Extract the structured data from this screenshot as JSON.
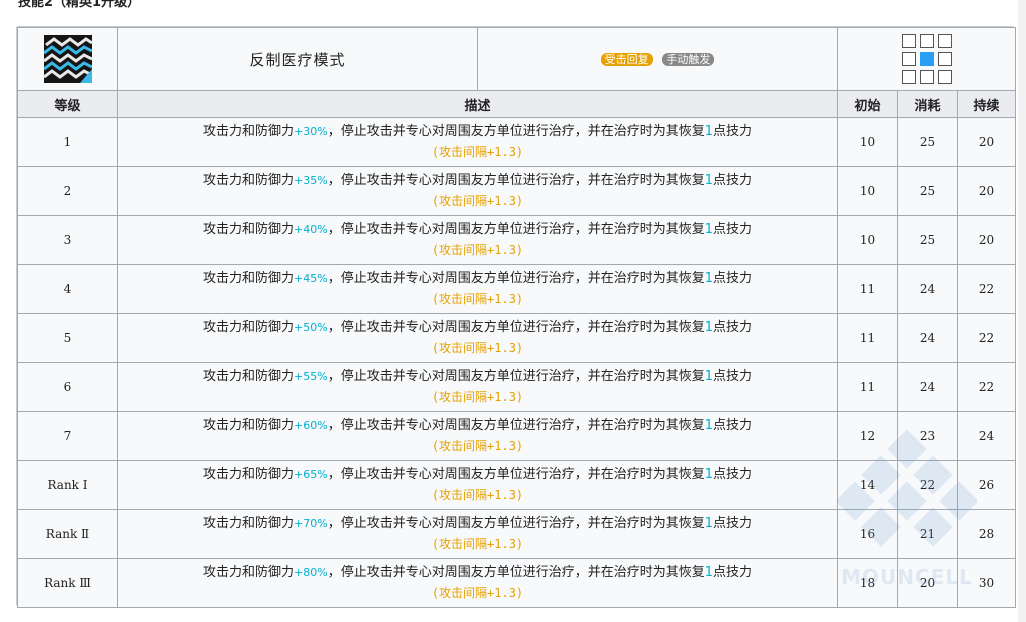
{
  "heading": "技能2（精英1升级）",
  "skill": {
    "name": "反制医疗模式",
    "sp_type": "受击回复",
    "trigger": "手动触发",
    "icon": "skill-icon-zigzag-chains"
  },
  "range": {
    "grid": [
      [
        0,
        0,
        0
      ],
      [
        0,
        1,
        0
      ],
      [
        0,
        0,
        0
      ]
    ]
  },
  "columns": {
    "level": "等级",
    "description": "描述",
    "initial": "初始",
    "cost": "消耗",
    "duration": "持续"
  },
  "rows": [
    {
      "level": "1",
      "desc_pre": "攻击力和防御力",
      "pct": "+30%",
      "desc_mid": "，停止攻击并专心对周围友方单位进行治疗，并在治疗时为其恢复",
      "sp_restore": "1",
      "desc_post": "点技力",
      "interval": "(攻击间隔+1.3)",
      "initial": "10",
      "cost": "25",
      "duration": "20"
    },
    {
      "level": "2",
      "desc_pre": "攻击力和防御力",
      "pct": "+35%",
      "desc_mid": "，停止攻击并专心对周围友方单位进行治疗，并在治疗时为其恢复",
      "sp_restore": "1",
      "desc_post": "点技力",
      "interval": "(攻击间隔+1.3)",
      "initial": "10",
      "cost": "25",
      "duration": "20"
    },
    {
      "level": "3",
      "desc_pre": "攻击力和防御力",
      "pct": "+40%",
      "desc_mid": "，停止攻击并专心对周围友方单位进行治疗，并在治疗时为其恢复",
      "sp_restore": "1",
      "desc_post": "点技力",
      "interval": "(攻击间隔+1.3)",
      "initial": "10",
      "cost": "25",
      "duration": "20"
    },
    {
      "level": "4",
      "desc_pre": "攻击力和防御力",
      "pct": "+45%",
      "desc_mid": "，停止攻击并专心对周围友方单位进行治疗，并在治疗时为其恢复",
      "sp_restore": "1",
      "desc_post": "点技力",
      "interval": "(攻击间隔+1.3)",
      "initial": "11",
      "cost": "24",
      "duration": "22"
    },
    {
      "level": "5",
      "desc_pre": "攻击力和防御力",
      "pct": "+50%",
      "desc_mid": "，停止攻击并专心对周围友方单位进行治疗，并在治疗时为其恢复",
      "sp_restore": "1",
      "desc_post": "点技力",
      "interval": "(攻击间隔+1.3)",
      "initial": "11",
      "cost": "24",
      "duration": "22"
    },
    {
      "level": "6",
      "desc_pre": "攻击力和防御力",
      "pct": "+55%",
      "desc_mid": "，停止攻击并专心对周围友方单位进行治疗，并在治疗时为其恢复",
      "sp_restore": "1",
      "desc_post": "点技力",
      "interval": "(攻击间隔+1.3)",
      "initial": "11",
      "cost": "24",
      "duration": "22"
    },
    {
      "level": "7",
      "desc_pre": "攻击力和防御力",
      "pct": "+60%",
      "desc_mid": "，停止攻击并专心对周围友方单位进行治疗，并在治疗时为其恢复",
      "sp_restore": "1",
      "desc_post": "点技力",
      "interval": "(攻击间隔+1.3)",
      "initial": "12",
      "cost": "23",
      "duration": "24"
    },
    {
      "level": "Rank Ⅰ",
      "desc_pre": "攻击力和防御力",
      "pct": "+65%",
      "desc_mid": "，停止攻击并专心对周围友方单位进行治疗，并在治疗时为其恢复",
      "sp_restore": "1",
      "desc_post": "点技力",
      "interval": "(攻击间隔+1.3)",
      "initial": "14",
      "cost": "22",
      "duration": "26"
    },
    {
      "level": "Rank Ⅱ",
      "desc_pre": "攻击力和防御力",
      "pct": "+70%",
      "desc_mid": "，停止攻击并专心对周围友方单位进行治疗，并在治疗时为其恢复",
      "sp_restore": "1",
      "desc_post": "点技力",
      "interval": "(攻击间隔+1.3)",
      "initial": "16",
      "cost": "21",
      "duration": "28"
    },
    {
      "level": "Rank Ⅲ",
      "desc_pre": "攻击力和防御力",
      "pct": "+80%",
      "desc_mid": "，停止攻击并专心对周围友方单位进行治疗，并在治疗时为其恢复",
      "sp_restore": "1",
      "desc_post": "点技力",
      "interval": "(攻击间隔+1.3)",
      "initial": "18",
      "cost": "20",
      "duration": "30"
    }
  ],
  "watermark": "MOUNCELL",
  "colors": {
    "accent_cyan": "#00b0d0",
    "interval_orange": "#e6a100",
    "sp_badge": "#e6a100",
    "trigger_badge": "#888888",
    "range_self": "#2a9df4",
    "header_bg": "#eaecf0",
    "border": "#a2a9b1"
  }
}
